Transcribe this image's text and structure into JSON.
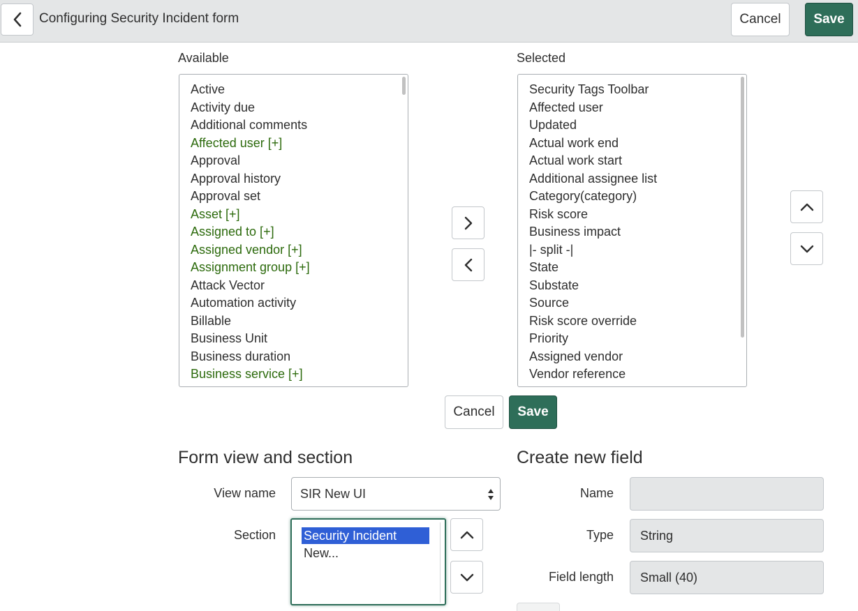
{
  "header": {
    "title": "Configuring Security Incident form",
    "cancel_label": "Cancel",
    "save_label": "Save"
  },
  "slushbucket": {
    "available_label": "Available",
    "selected_label": "Selected",
    "available_items": [
      {
        "label": "Active",
        "reference": false
      },
      {
        "label": "Activity due",
        "reference": false
      },
      {
        "label": "Additional comments",
        "reference": false
      },
      {
        "label": "Affected user [+]",
        "reference": true
      },
      {
        "label": "Approval",
        "reference": false
      },
      {
        "label": "Approval history",
        "reference": false
      },
      {
        "label": "Approval set",
        "reference": false
      },
      {
        "label": "Asset [+]",
        "reference": true
      },
      {
        "label": "Assigned to [+]",
        "reference": true
      },
      {
        "label": "Assigned vendor [+]",
        "reference": true
      },
      {
        "label": "Assignment group [+]",
        "reference": true
      },
      {
        "label": "Attack Vector",
        "reference": false
      },
      {
        "label": "Automation activity",
        "reference": false
      },
      {
        "label": "Billable",
        "reference": false
      },
      {
        "label": "Business Unit",
        "reference": false
      },
      {
        "label": "Business duration",
        "reference": false
      },
      {
        "label": "Business service [+]",
        "reference": true
      }
    ],
    "selected_items": [
      "Security Tags Toolbar",
      "Affected user",
      "Updated",
      "Actual work end",
      "Actual work start",
      "Additional assignee list",
      "Category(category)",
      "Risk score",
      "Business impact",
      "|- split -|",
      "State",
      "Substate",
      "Source",
      "Risk score override",
      "Priority",
      "Assigned vendor",
      "Vendor reference"
    ],
    "cancel_label": "Cancel",
    "save_label": "Save"
  },
  "form_view": {
    "title": "Form view and section",
    "view_name_label": "View name",
    "view_name_value": "SIR New UI",
    "section_label": "Section",
    "section_options": [
      "Security Incident",
      "New..."
    ],
    "selected_section": "Security Incident"
  },
  "create_field": {
    "title": "Create new field",
    "name_label": "Name",
    "name_value": "",
    "type_label": "Type",
    "type_value": "String",
    "field_length_label": "Field length",
    "field_length_value": "Small (40)"
  },
  "colors": {
    "primary": "#2e6e59",
    "reference_text": "#2c6a0c",
    "selection": "#2f5fd6",
    "header_bg": "#e4e6e7"
  },
  "icons": {
    "back": "chevron-left-icon",
    "add": "chevron-right-icon",
    "remove": "chevron-left-icon",
    "move_up": "chevron-up-icon",
    "move_down": "chevron-down-icon"
  }
}
